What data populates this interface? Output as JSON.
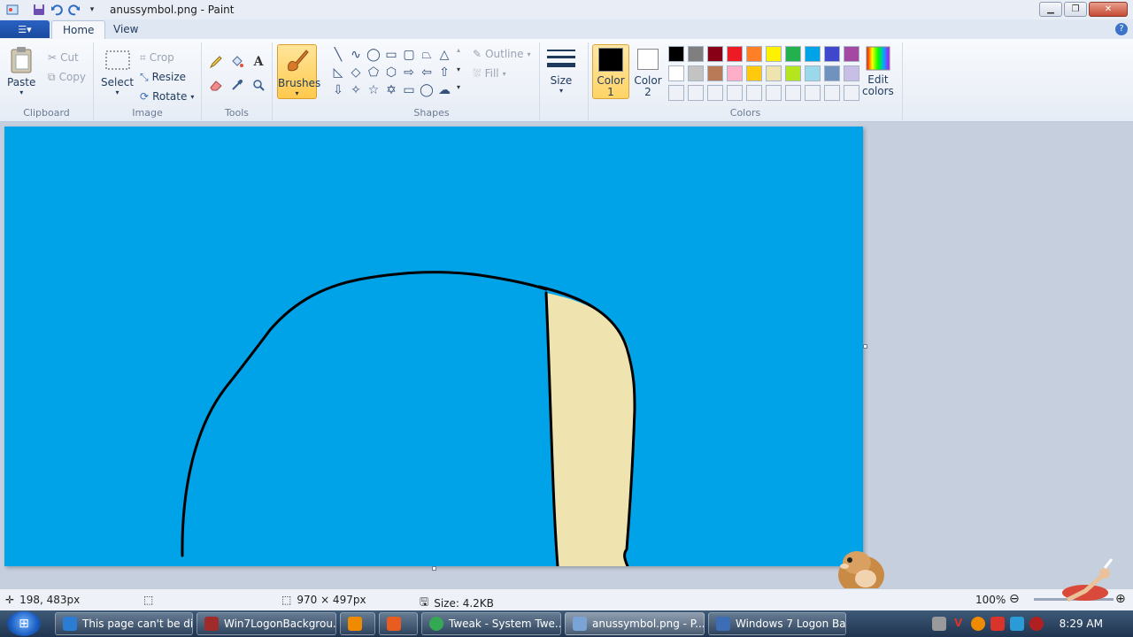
{
  "window": {
    "title": "anussymbol.png - Paint"
  },
  "quick_access": [
    "save-icon",
    "undo-icon",
    "redo-icon",
    "customize-icon"
  ],
  "menu": {
    "app_button": "☰▾",
    "tabs": [
      "Home",
      "View"
    ]
  },
  "ribbon": {
    "clipboard": {
      "paste": "Paste",
      "cut": "Cut",
      "copy": "Copy",
      "label": "Clipboard"
    },
    "image": {
      "select": "Select",
      "crop": "Crop",
      "resize": "Resize",
      "rotate": "Rotate",
      "label": "Image"
    },
    "tools": {
      "label": "Tools"
    },
    "brushes": {
      "label": "Brushes"
    },
    "shapes": {
      "outline": "Outline",
      "fill": "Fill",
      "label": "Shapes"
    },
    "size": {
      "label": "Size"
    },
    "colors": {
      "color1_label": "Color",
      "color1_num": "1",
      "color2_label": "Color",
      "color2_num": "2",
      "edit_label": "Edit",
      "edit_label2": "colors",
      "label": "Colors",
      "color1": "#000000",
      "color2": "#ffffff",
      "palette": [
        "#000000",
        "#7f7f7f",
        "#880015",
        "#ed1c24",
        "#ff7f27",
        "#fff200",
        "#22b14c",
        "#00a2e8",
        "#3f48cc",
        "#a349a4",
        "#ffffff",
        "#c3c3c3",
        "#b97a57",
        "#ffaec9",
        "#ffc90e",
        "#efe4b0",
        "#b5e61d",
        "#99d9ea",
        "#7092be",
        "#c8bfe7"
      ]
    }
  },
  "canvas": {
    "background": "#00a2e8",
    "fill_shape": "#efe4b0",
    "stroke": "#000000"
  },
  "status": {
    "cursor_pos": "198, 483px",
    "image_size": "970 × 497px",
    "file_size": "Size: 4.2KB",
    "zoom": "100%"
  },
  "taskbar": {
    "tasks": [
      {
        "label": "This page can't be di...",
        "icon_color": "#2b7cd3"
      },
      {
        "label": "Win7LogonBackgrou...",
        "icon_color": "#a02b2b"
      },
      {
        "label": "",
        "icon_color": "#f08a00"
      },
      {
        "label": "",
        "icon_color": "#e85d1f"
      },
      {
        "label": "Tweak - System Twe...",
        "icon_color": "#34a853"
      },
      {
        "label": "anussymbol.png - P...",
        "icon_color": "#7aa4d6"
      },
      {
        "label": "Windows 7 Logon Ba...",
        "icon_color": "#3d6db5"
      }
    ],
    "clock": "8:29 AM"
  }
}
